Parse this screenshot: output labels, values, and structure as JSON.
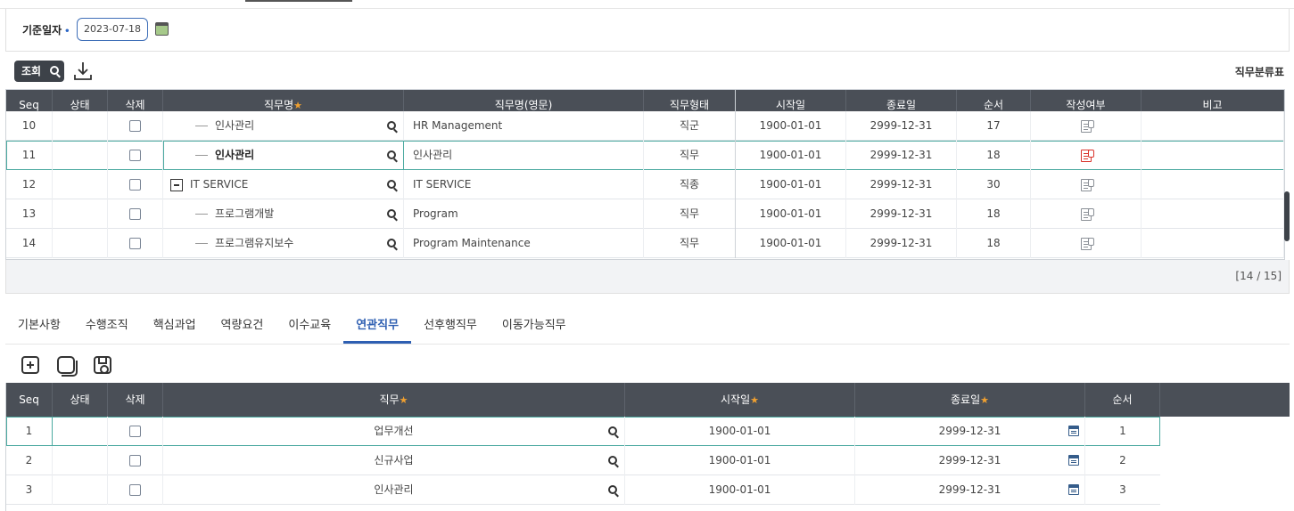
{
  "filter": {
    "label": "기준일자",
    "required_mark": "•",
    "date_value": "2023-07-18"
  },
  "toolbar": {
    "search_label": "조회",
    "grid_title": "직무분류표"
  },
  "grid1": {
    "headers": [
      "Seq",
      "상태",
      "삭제",
      "직무명",
      "직무명(영문)",
      "직무형태",
      "시작일",
      "종료일",
      "순서",
      "작성여부",
      "비고"
    ],
    "rows": [
      {
        "seq": "10",
        "name": "인사관리",
        "name_en": "HR Management",
        "type": "직군",
        "start": "1900-01-01",
        "end": "2999-12-31",
        "order": "17"
      },
      {
        "seq": "11",
        "name": "인사관리",
        "name_en": "인사관리",
        "type": "직무",
        "start": "1900-01-01",
        "end": "2999-12-31",
        "order": "18"
      },
      {
        "seq": "12",
        "name": "IT SERVICE",
        "name_en": "IT SERVICE",
        "type": "직종",
        "start": "1900-01-01",
        "end": "2999-12-31",
        "order": "30"
      },
      {
        "seq": "13",
        "name": "프로그램개발",
        "name_en": "Program",
        "type": "직무",
        "start": "1900-01-01",
        "end": "2999-12-31",
        "order": "18"
      },
      {
        "seq": "14",
        "name": "프로그램유지보수",
        "name_en": "Program Maintenance",
        "type": "직무",
        "start": "1900-01-01",
        "end": "2999-12-31",
        "order": "18"
      }
    ],
    "page_count": "[14 / 15]"
  },
  "tabs": [
    "기본사항",
    "수행조직",
    "핵심과업",
    "역량요건",
    "이수교육",
    "연관직무",
    "선후행직무",
    "이동가능직무"
  ],
  "active_tab": "연관직무",
  "grid2": {
    "headers": [
      "Seq",
      "상태",
      "삭제",
      "직무",
      "시작일",
      "종료일",
      "순서"
    ],
    "rows": [
      {
        "seq": "1",
        "job": "업무개선",
        "start": "1900-01-01",
        "end": "2999-12-31",
        "order": "1"
      },
      {
        "seq": "2",
        "job": "신규사업",
        "start": "1900-01-01",
        "end": "2999-12-31",
        "order": "2"
      },
      {
        "seq": "3",
        "job": "인사관리",
        "start": "1900-01-01",
        "end": "2999-12-31",
        "order": "3"
      }
    ]
  },
  "colors": {
    "header_bg": "#4a4f57",
    "accent_blue": "#2e5fb2",
    "selection_teal": "#4aa9a0",
    "required_star": "#f0a030",
    "alert_red": "#d9332b"
  }
}
